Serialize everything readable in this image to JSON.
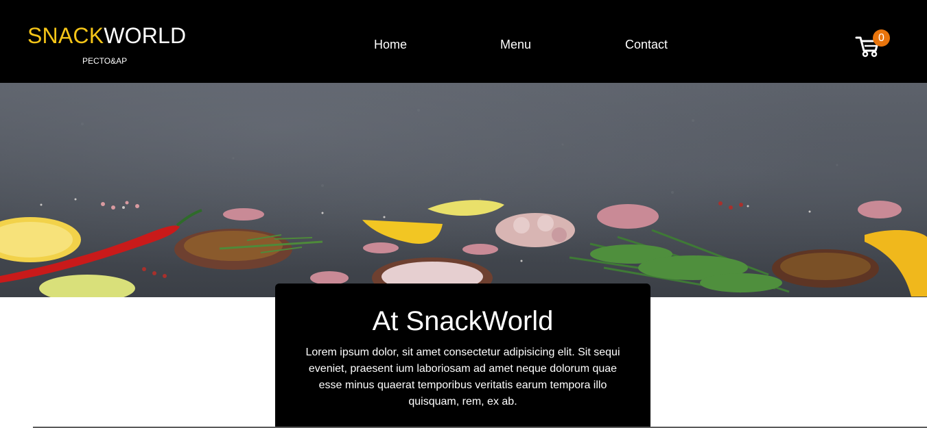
{
  "brand": {
    "name_part_a": "SNACK",
    "name_part_b": "WORLD",
    "tagline": "PECTO&AP",
    "accent_color": "#f5c518"
  },
  "nav": {
    "items": [
      "Home",
      "Menu",
      "Contact"
    ]
  },
  "cart": {
    "icon": "shopping-cart-icon",
    "count": "0",
    "badge_color": "#e8740c"
  },
  "hero": {
    "image": "spices-and-herbs-on-dark-stone-banner"
  },
  "about": {
    "title": "At SnackWorld",
    "body": "Lorem ipsum dolor, sit amet consectetur adipisicing elit. Sit sequi eveniet, praesent ium laboriosam ad amet neque dolorum quae esse minus quaerat temporibus veritatis earum tempora illo quisquam, rem, ex ab."
  }
}
